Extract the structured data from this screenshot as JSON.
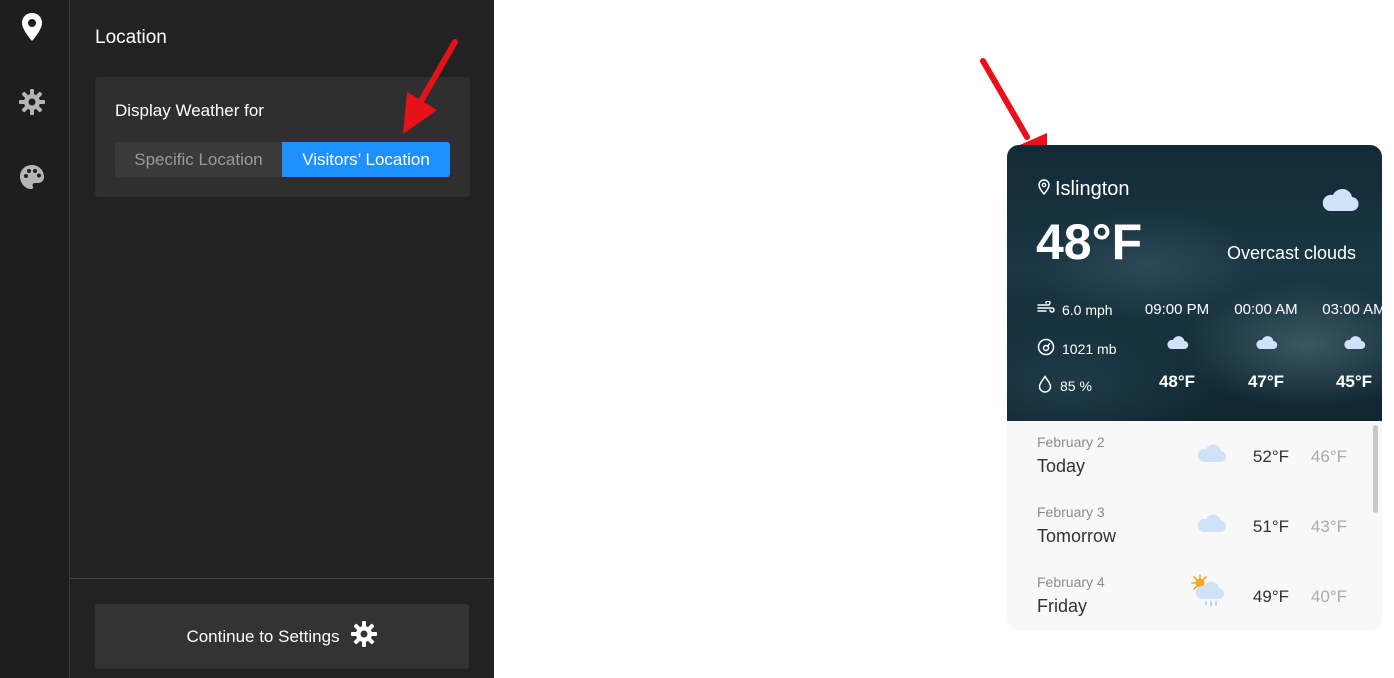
{
  "rail": {
    "items": [
      {
        "icon": "location-pin-icon"
      },
      {
        "icon": "gear-icon"
      },
      {
        "icon": "palette-icon"
      }
    ]
  },
  "panel": {
    "title": "Location",
    "display_label": "Display Weather for",
    "options": [
      "Specific Location",
      "Visitors’ Location"
    ],
    "selected": "Visitors’ Location",
    "continue_label": "Continue to Settings"
  },
  "colors": {
    "accent": "#1e90ff",
    "panel_bg": "#222222",
    "rail_bg": "#1e1e1e",
    "arrow": "#e8111a"
  },
  "widget": {
    "city": "Islington",
    "temperature": "48°F",
    "condition": "Overcast clouds",
    "wind": "6.0 mph",
    "pressure": "1021 mb",
    "humidity": "85 %",
    "hourly": [
      {
        "time": "09:00 PM",
        "temp": "48°F",
        "icon": "cloud-icon"
      },
      {
        "time": "00:00 AM",
        "temp": "47°F",
        "icon": "cloud-icon"
      },
      {
        "time": "03:00 AM",
        "temp": "45°F",
        "icon": "cloud-icon"
      }
    ],
    "daily": [
      {
        "date": "February 2",
        "day": "Today",
        "high": "52°F",
        "low": "46°F",
        "icon": "cloud-icon"
      },
      {
        "date": "February 3",
        "day": "Tomorrow",
        "high": "51°F",
        "low": "43°F",
        "icon": "cloud-icon"
      },
      {
        "date": "February 4",
        "day": "Friday",
        "high": "49°F",
        "low": "40°F",
        "icon": "sun-cloud-rain-icon"
      }
    ]
  }
}
